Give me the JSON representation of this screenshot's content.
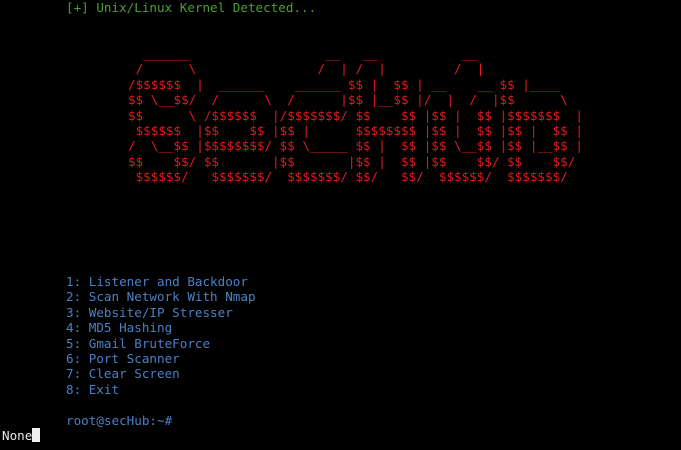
{
  "terminal": {
    "status_line": "[+] Unix/Linux Kernel Detected...",
    "banner_art": "  ______                  __   __           __\n /      \\                /  | /  |         /  |\n/$$$$$$  |  ______    ______ $$ |  $$ | __    __ $$ |____\n$$ \\__$$/  /      \\  /      |$$ |__$$ |/  |  /  |$$      \\\n$$      \\ /$$$$$$  |/$$$$$$$/ $$    $$ |$$ |  $$ |$$$$$$$  |\n $$$$$$  |$$    $$ |$$ |      $$$$$$$$ |$$ |  $$ |$$ |  $$ |\n/  \\__$$ |$$$$$$$$/ $$ \\_____ $$ |  $$ |$$ \\__$$ |$$ |__$$ |\n$$    $$/ $$       |$$       |$$ |  $$ |$$    $$/ $$    $$/\n $$$$$$/   $$$$$$$/  $$$$$$$/ $$/   $$/  $$$$$$/  $$$$$$$/",
    "menu_items": [
      "1: Listener and Backdoor",
      "2: Scan Network With Nmap",
      "3: Website/IP Stresser",
      "4: MD5 Hashing",
      "5: Gmail BruteForce",
      "6: Port Scanner",
      "7: Clear Screen",
      "8: Exit"
    ],
    "prompt": "root@secHub:~#",
    "output": "None"
  },
  "colors": {
    "background": "#000000",
    "status_green": "#4aa02c",
    "banner_red": "#e01b1b",
    "menu_blue": "#4b80c4",
    "text_white": "#e8e8e8"
  }
}
